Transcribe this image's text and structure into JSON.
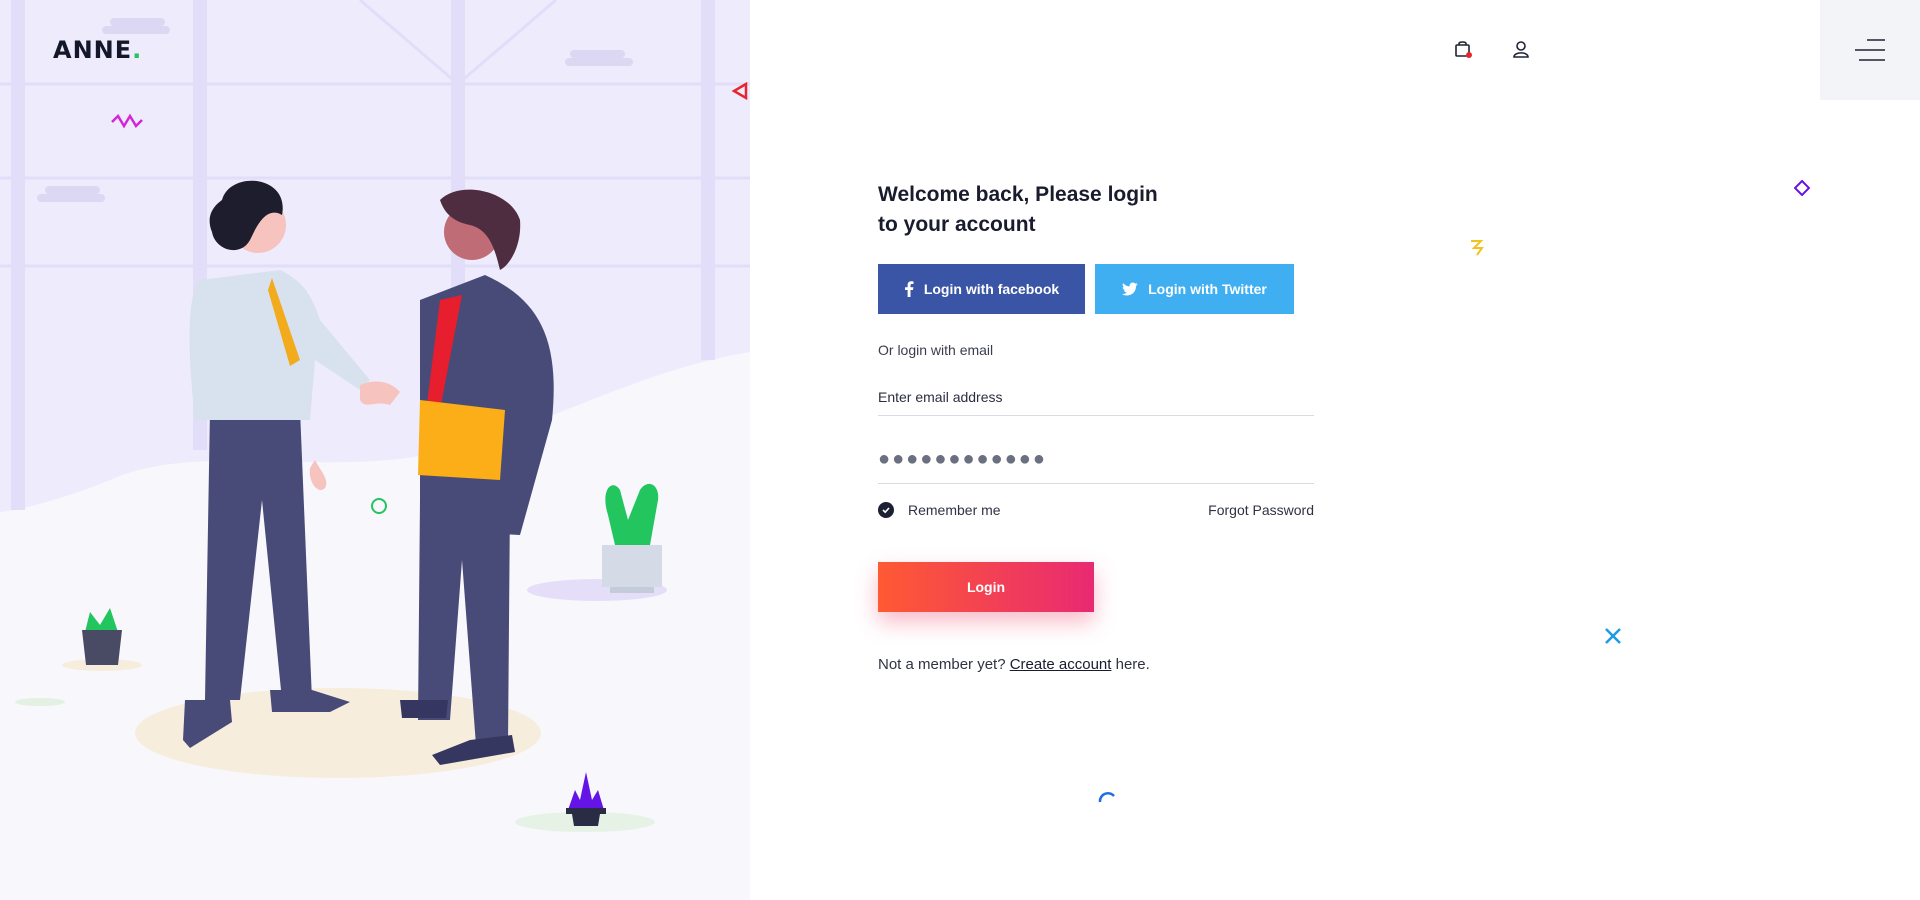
{
  "brand": {
    "name": "ANNE",
    "dot": "."
  },
  "header": {
    "cart_icon": "shopping-bag-icon",
    "user_icon": "user-icon",
    "menu_icon": "hamburger-menu-icon"
  },
  "form": {
    "heading": "Welcome back, Please login\nto your account",
    "facebook_label": "Login with facebook",
    "twitter_label": "Login with Twitter",
    "or_text": "Or login with email",
    "email_placeholder": "Enter email address",
    "password_value": "●●●●●●●●●●●●",
    "remember_label": "Remember me",
    "remember_checked": true,
    "forgot_label": "Forgot Password",
    "login_label": "Login",
    "member_prefix": "Not a member yet? ",
    "member_link": "Create account",
    "member_suffix": " here."
  },
  "colors": {
    "facebook": "#3b55a6",
    "twitter": "#3faff2",
    "login_gradient_start": "#fe5a33",
    "login_gradient_end": "#e82a72",
    "brand_dot": "#22c55e",
    "panel_bg": "#f7f7fc"
  }
}
